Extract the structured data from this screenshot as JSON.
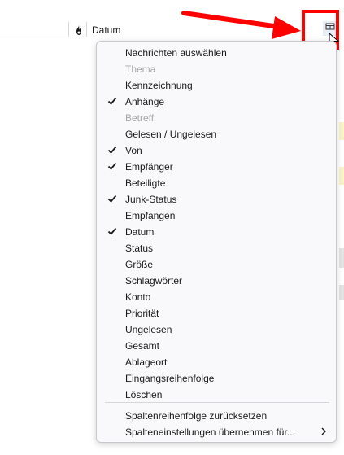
{
  "header": {
    "date_column_label": "Datum",
    "junk_icon": "flame-icon",
    "column_picker_icon": "column-picker-icon"
  },
  "annotation": {
    "highlight_color": "#ff0000"
  },
  "menu": {
    "items": [
      {
        "label": "Nachrichten auswählen",
        "checked": false,
        "disabled": false
      },
      {
        "label": "Thema",
        "checked": false,
        "disabled": true
      },
      {
        "label": "Kennzeichnung",
        "checked": false,
        "disabled": false
      },
      {
        "label": "Anhänge",
        "checked": true,
        "disabled": false
      },
      {
        "label": "Betreff",
        "checked": false,
        "disabled": true
      },
      {
        "label": "Gelesen / Ungelesen",
        "checked": false,
        "disabled": false
      },
      {
        "label": "Von",
        "checked": true,
        "disabled": false
      },
      {
        "label": "Empfänger",
        "checked": true,
        "disabled": false
      },
      {
        "label": "Beteiligte",
        "checked": false,
        "disabled": false
      },
      {
        "label": "Junk-Status",
        "checked": true,
        "disabled": false
      },
      {
        "label": "Empfangen",
        "checked": false,
        "disabled": false
      },
      {
        "label": "Datum",
        "checked": true,
        "disabled": false
      },
      {
        "label": "Status",
        "checked": false,
        "disabled": false
      },
      {
        "label": "Größe",
        "checked": false,
        "disabled": false
      },
      {
        "label": "Schlagwörter",
        "checked": false,
        "disabled": false
      },
      {
        "label": "Konto",
        "checked": false,
        "disabled": false
      },
      {
        "label": "Priorität",
        "checked": false,
        "disabled": false
      },
      {
        "label": "Ungelesen",
        "checked": false,
        "disabled": false
      },
      {
        "label": "Gesamt",
        "checked": false,
        "disabled": false
      },
      {
        "label": "Ablageort",
        "checked": false,
        "disabled": false
      },
      {
        "label": "Eingangsreihenfolge",
        "checked": false,
        "disabled": false
      },
      {
        "label": "Löschen",
        "checked": false,
        "disabled": false
      }
    ],
    "reset_order_label": "Spaltenreihenfolge zurücksetzen",
    "apply_settings_label": "Spalteneinstellungen übernehmen für..."
  }
}
